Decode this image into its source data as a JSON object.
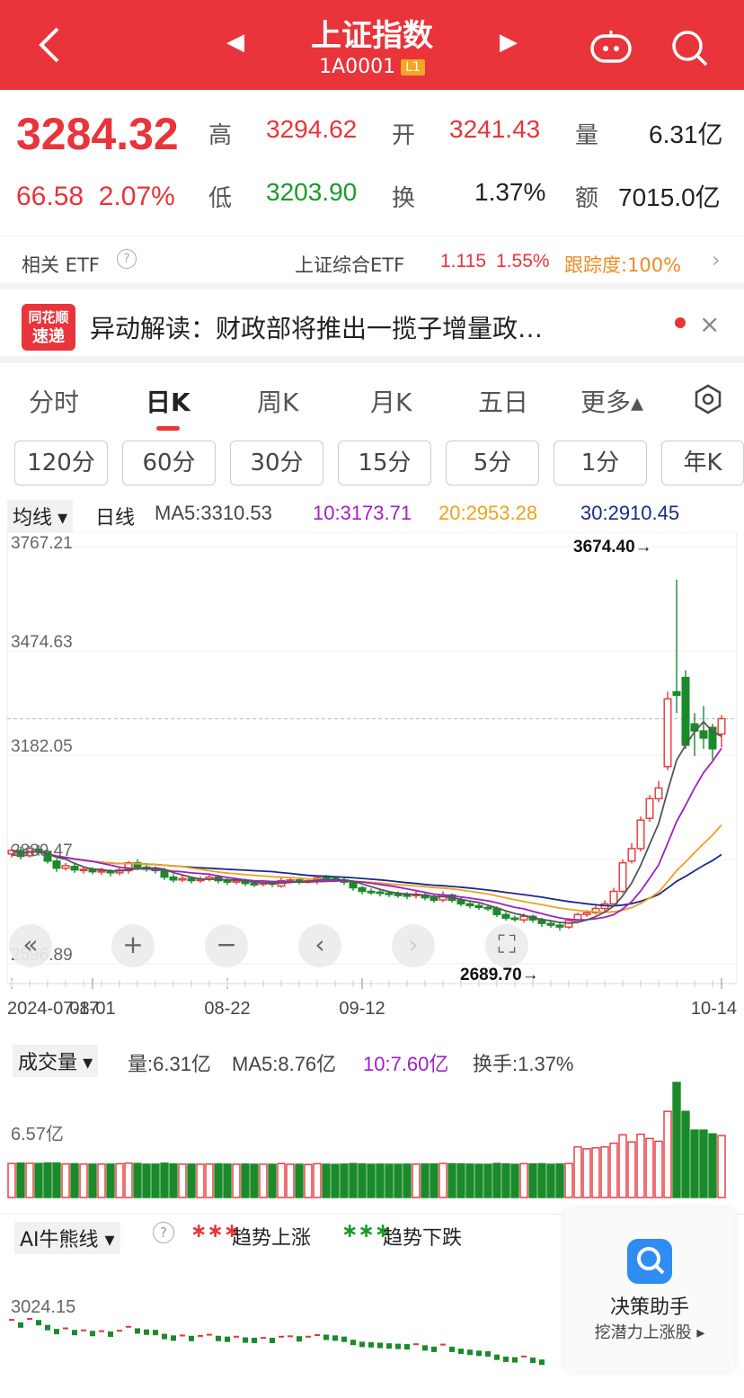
{
  "header": {
    "title": "上证指数",
    "code": "1A0001",
    "badge": "L1",
    "back_glyph": "‹",
    "prev_glyph": "◀",
    "next_glyph": "▶"
  },
  "quote": {
    "price": "3284.32",
    "change": "66.58",
    "change_pct": "2.07%",
    "high_label": "高",
    "high": "3294.62",
    "open_label": "开",
    "open": "3241.43",
    "volume_label": "量",
    "volume": "6.31亿",
    "low_label": "低",
    "low": "3203.90",
    "turnover_label": "换",
    "turnover": "1.37%",
    "amount_label": "额",
    "amount": "7015.0亿"
  },
  "etf": {
    "label": "相关 ETF",
    "name": "上证综合ETF",
    "price": "1.115",
    "pct": "1.55%",
    "tracking": "跟踪度:100%"
  },
  "news": {
    "logo_line1": "同花顺",
    "logo_line2": "速递",
    "text": "异动解读：财政部将推出一揽子增量政…"
  },
  "tabs": [
    {
      "label": "分时"
    },
    {
      "label": "日K"
    },
    {
      "label": "周K"
    },
    {
      "label": "月K"
    },
    {
      "label": "五日"
    },
    {
      "label": "更多▴"
    }
  ],
  "periods": [
    "120分",
    "60分",
    "30分",
    "15分",
    "5分",
    "1分",
    "年K"
  ],
  "ma": {
    "selector": "均线 ▾",
    "period": "日线",
    "ma5": "MA5:3310.53",
    "ma10": "10:3173.71",
    "ma20": "20:2953.28",
    "ma30": "30:2910.45"
  },
  "chart_data": {
    "type": "candlestick",
    "y_ticks": [
      "3767.21",
      "3474.63",
      "3182.05",
      "2889.47",
      "2596.89"
    ],
    "x_ticks": [
      "2024-07-17",
      "08-01",
      "08-22",
      "09-12",
      "10-14"
    ],
    "high_marker": "3674.40→",
    "low_marker": "2689.70→",
    "ylim": [
      2596.89,
      3767.21
    ],
    "candles": [
      {
        "o": 2905,
        "c": 2915,
        "h": 2925,
        "l": 2895
      },
      {
        "o": 2915,
        "c": 2898,
        "h": 2925,
        "l": 2890
      },
      {
        "o": 2900,
        "c": 2920,
        "h": 2928,
        "l": 2895
      },
      {
        "o": 2918,
        "c": 2910,
        "h": 2930,
        "l": 2900
      },
      {
        "o": 2912,
        "c": 2885,
        "h": 2916,
        "l": 2878
      },
      {
        "o": 2885,
        "c": 2865,
        "h": 2892,
        "l": 2855
      },
      {
        "o": 2865,
        "c": 2872,
        "h": 2880,
        "l": 2858
      },
      {
        "o": 2870,
        "c": 2860,
        "h": 2878,
        "l": 2852
      },
      {
        "o": 2860,
        "c": 2862,
        "h": 2870,
        "l": 2850
      },
      {
        "o": 2862,
        "c": 2855,
        "h": 2868,
        "l": 2848
      },
      {
        "o": 2855,
        "c": 2858,
        "h": 2866,
        "l": 2846
      },
      {
        "o": 2856,
        "c": 2852,
        "h": 2862,
        "l": 2842
      },
      {
        "o": 2852,
        "c": 2860,
        "h": 2870,
        "l": 2845
      },
      {
        "o": 2858,
        "c": 2880,
        "h": 2885,
        "l": 2850
      },
      {
        "o": 2880,
        "c": 2868,
        "h": 2890,
        "l": 2860
      },
      {
        "o": 2868,
        "c": 2862,
        "h": 2874,
        "l": 2855
      },
      {
        "o": 2862,
        "c": 2860,
        "h": 2870,
        "l": 2850
      },
      {
        "o": 2860,
        "c": 2840,
        "h": 2866,
        "l": 2832
      },
      {
        "o": 2840,
        "c": 2832,
        "h": 2848,
        "l": 2825
      },
      {
        "o": 2832,
        "c": 2836,
        "h": 2845,
        "l": 2826
      },
      {
        "o": 2836,
        "c": 2830,
        "h": 2842,
        "l": 2822
      },
      {
        "o": 2830,
        "c": 2834,
        "h": 2842,
        "l": 2824
      },
      {
        "o": 2834,
        "c": 2840,
        "h": 2848,
        "l": 2828
      },
      {
        "o": 2840,
        "c": 2830,
        "h": 2846,
        "l": 2822
      },
      {
        "o": 2830,
        "c": 2826,
        "h": 2838,
        "l": 2818
      },
      {
        "o": 2826,
        "c": 2830,
        "h": 2838,
        "l": 2820
      },
      {
        "o": 2830,
        "c": 2822,
        "h": 2836,
        "l": 2815
      },
      {
        "o": 2822,
        "c": 2820,
        "h": 2830,
        "l": 2812
      },
      {
        "o": 2820,
        "c": 2824,
        "h": 2832,
        "l": 2814
      },
      {
        "o": 2824,
        "c": 2820,
        "h": 2830,
        "l": 2812
      },
      {
        "o": 2815,
        "c": 2830,
        "h": 2838,
        "l": 2810
      },
      {
        "o": 2830,
        "c": 2832,
        "h": 2840,
        "l": 2822
      },
      {
        "o": 2832,
        "c": 2828,
        "h": 2838,
        "l": 2820
      },
      {
        "o": 2828,
        "c": 2830,
        "h": 2836,
        "l": 2822
      },
      {
        "o": 2828,
        "c": 2838,
        "h": 2845,
        "l": 2820
      },
      {
        "o": 2838,
        "c": 2836,
        "h": 2846,
        "l": 2828
      },
      {
        "o": 2836,
        "c": 2832,
        "h": 2842,
        "l": 2826
      },
      {
        "o": 2832,
        "c": 2826,
        "h": 2838,
        "l": 2818
      },
      {
        "o": 2826,
        "c": 2810,
        "h": 2830,
        "l": 2802
      },
      {
        "o": 2810,
        "c": 2800,
        "h": 2815,
        "l": 2792
      },
      {
        "o": 2800,
        "c": 2798,
        "h": 2808,
        "l": 2790
      },
      {
        "o": 2798,
        "c": 2795,
        "h": 2806,
        "l": 2786
      },
      {
        "o": 2795,
        "c": 2792,
        "h": 2802,
        "l": 2784
      },
      {
        "o": 2792,
        "c": 2790,
        "h": 2800,
        "l": 2782
      },
      {
        "o": 2790,
        "c": 2788,
        "h": 2798,
        "l": 2778
      },
      {
        "o": 2788,
        "c": 2792,
        "h": 2800,
        "l": 2780
      },
      {
        "o": 2790,
        "c": 2782,
        "h": 2796,
        "l": 2775
      },
      {
        "o": 2782,
        "c": 2775,
        "h": 2790,
        "l": 2768
      },
      {
        "o": 2776,
        "c": 2790,
        "h": 2800,
        "l": 2770
      },
      {
        "o": 2790,
        "c": 2775,
        "h": 2794,
        "l": 2768
      },
      {
        "o": 2775,
        "c": 2765,
        "h": 2782,
        "l": 2758
      },
      {
        "o": 2765,
        "c": 2760,
        "h": 2772,
        "l": 2752
      },
      {
        "o": 2760,
        "c": 2755,
        "h": 2766,
        "l": 2748
      },
      {
        "o": 2755,
        "c": 2752,
        "h": 2762,
        "l": 2745
      },
      {
        "o": 2752,
        "c": 2735,
        "h": 2758,
        "l": 2728
      },
      {
        "o": 2735,
        "c": 2725,
        "h": 2742,
        "l": 2718
      },
      {
        "o": 2725,
        "c": 2722,
        "h": 2732,
        "l": 2715
      },
      {
        "o": 2720,
        "c": 2730,
        "h": 2738,
        "l": 2712
      },
      {
        "o": 2730,
        "c": 2720,
        "h": 2735,
        "l": 2712
      },
      {
        "o": 2720,
        "c": 2710,
        "h": 2726,
        "l": 2700
      },
      {
        "o": 2710,
        "c": 2705,
        "h": 2716,
        "l": 2698
      },
      {
        "o": 2705,
        "c": 2700,
        "h": 2712,
        "l": 2690
      },
      {
        "o": 2700,
        "c": 2718,
        "h": 2725,
        "l": 2695
      },
      {
        "o": 2715,
        "c": 2735,
        "h": 2740,
        "l": 2710
      },
      {
        "o": 2735,
        "c": 2740,
        "h": 2748,
        "l": 2728
      },
      {
        "o": 2740,
        "c": 2752,
        "h": 2760,
        "l": 2735
      },
      {
        "o": 2752,
        "c": 2765,
        "h": 2775,
        "l": 2745
      },
      {
        "o": 2765,
        "c": 2800,
        "h": 2810,
        "l": 2760
      },
      {
        "o": 2800,
        "c": 2880,
        "h": 2890,
        "l": 2795
      },
      {
        "o": 2885,
        "c": 2920,
        "h": 2935,
        "l": 2878
      },
      {
        "o": 2920,
        "c": 3000,
        "h": 3010,
        "l": 2912
      },
      {
        "o": 3005,
        "c": 3060,
        "h": 3070,
        "l": 2995
      },
      {
        "o": 3060,
        "c": 3090,
        "h": 3110,
        "l": 3050
      },
      {
        "o": 3150,
        "c": 3340,
        "h": 3360,
        "l": 3140
      },
      {
        "o": 3360,
        "c": 3350,
        "h": 3674.4,
        "l": 3300
      },
      {
        "o": 3400,
        "c": 3210,
        "h": 3420,
        "l": 3200
      },
      {
        "o": 3270,
        "c": 3250,
        "h": 3300,
        "l": 3180
      },
      {
        "o": 3250,
        "c": 3230,
        "h": 3320,
        "l": 3200
      },
      {
        "o": 3260,
        "c": 3200,
        "h": 3270,
        "l": 3170
      },
      {
        "o": 3241.43,
        "c": 3284.32,
        "h": 3294.62,
        "l": 3203.9
      }
    ]
  },
  "volume": {
    "selector": "成交量 ▾",
    "vol": "量:6.31亿",
    "ma5": "MA5:8.76亿",
    "ma10": "10:7.60亿",
    "turnover": "换手:1.37%",
    "y_tick": "6.57亿"
  },
  "ai": {
    "selector": "AI牛熊线 ▾",
    "help": "?",
    "up_legend": "趋势上涨",
    "down_legend": "趋势下跌",
    "y_tick": "3024.15"
  },
  "helper": {
    "title": "决策助手",
    "sub": "挖潜力上涨股 ▸"
  },
  "colors": {
    "up": "#e8343a",
    "down": "#1a8a2a",
    "ma5": "#555555",
    "ma10": "#a020c0",
    "ma20": "#f0a020",
    "ma30": "#1a2a8a"
  }
}
